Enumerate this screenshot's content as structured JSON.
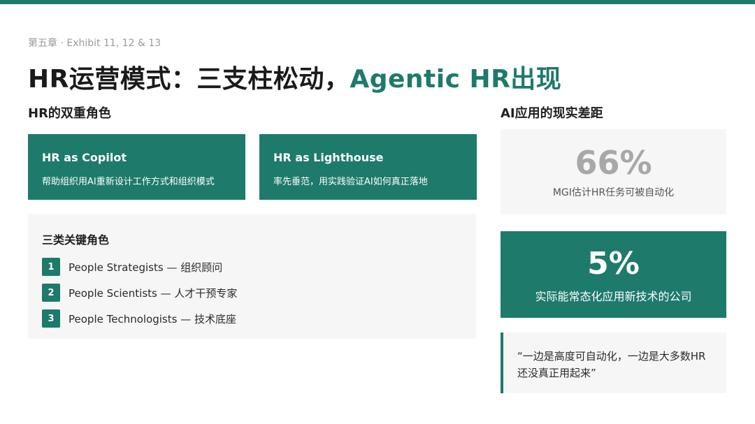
{
  "colors": {
    "accent": "#1e7a6b",
    "panel_bg": "#f6f6f6",
    "muted_stat": "#a8a8a8"
  },
  "header": {
    "eyebrow": "第五章 · Exhibit 11, 12 & 13",
    "title_main": "HR运营模式：三支柱松动，",
    "title_accent": "Agentic HR出现"
  },
  "left": {
    "section_label": "HR的双重角色",
    "cards": [
      {
        "title": "HR as Copilot",
        "desc": "帮助组织用AI重新设计工作方式和组织模式"
      },
      {
        "title": "HR as Lighthouse",
        "desc": "率先垂范，用实践验证AI如何真正落地"
      }
    ],
    "key_roles": {
      "title": "三类关键角色",
      "items": [
        {
          "num": "1",
          "label": "People Strategists — 组织顾问"
        },
        {
          "num": "2",
          "label": "People Scientists — 人才干预专家"
        },
        {
          "num": "3",
          "label": "People Technologists — 技术底座"
        }
      ]
    }
  },
  "right": {
    "section_label": "AI应用的现实差距",
    "stat_automatable": {
      "value": "66%",
      "caption": "MGI估计HR任务可被自动化"
    },
    "stat_adopted": {
      "value": "5%",
      "caption": "实际能常态化应用新技术的公司"
    },
    "quote": "“一边是高度可自动化，一边是大多数HR还没真正用起来”"
  }
}
